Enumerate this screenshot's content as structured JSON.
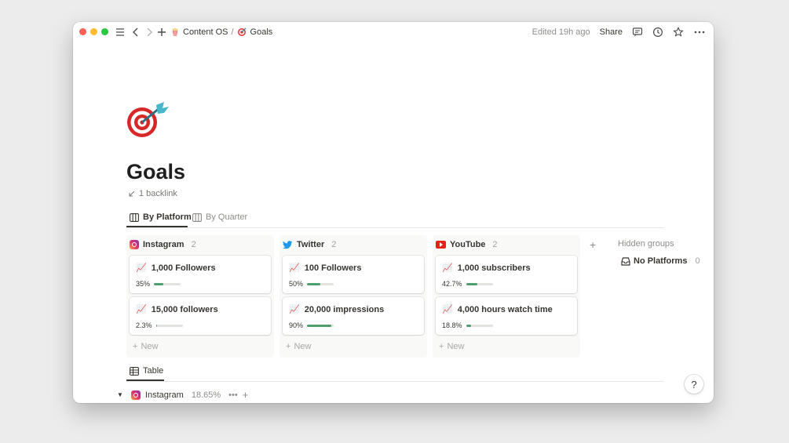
{
  "window": {
    "dot_colors": [
      "#fe5f57",
      "#febc2e",
      "#28c840"
    ]
  },
  "breadcrumb": {
    "workspace": "Content OS",
    "separator": "/",
    "page": "Goals"
  },
  "topbar": {
    "edited": "Edited 19h ago",
    "share": "Share"
  },
  "page": {
    "title": "Goals",
    "backlink": "1 backlink"
  },
  "views": {
    "tab1": "By Platform",
    "tab2": "By Quarter"
  },
  "board": {
    "columns": [
      {
        "name": "Instagram",
        "count": "2",
        "icon": "instagram-icon",
        "cards": [
          {
            "title": "1,000 Followers",
            "progress_label": "35%",
            "progress": 0.35
          },
          {
            "title": "15,000 followers",
            "progress_label": "2.3%",
            "progress": 0.023
          }
        ]
      },
      {
        "name": "Twitter",
        "count": "2",
        "icon": "twitter-icon",
        "cards": [
          {
            "title": "100 Followers",
            "progress_label": "50%",
            "progress": 0.5
          },
          {
            "title": "20,000 impressions",
            "progress_label": "90%",
            "progress": 0.9
          }
        ]
      },
      {
        "name": "YouTube",
        "count": "2",
        "icon": "youtube-icon",
        "cards": [
          {
            "title": "1,000 subscribers",
            "progress_label": "42.7%",
            "progress": 0.427
          },
          {
            "title": "4,000 hours watch time",
            "progress_label": "18.8%",
            "progress": 0.188
          }
        ]
      }
    ],
    "new_label": "New",
    "hidden_groups": "Hidden groups",
    "no_platforms": {
      "label": "No Platforms",
      "count": "0"
    }
  },
  "table_view": {
    "tab": "Table",
    "group": {
      "name": "Instagram",
      "value": "18.65%"
    }
  },
  "help": "?",
  "colors": {
    "progress_fill": "#4d9e6a",
    "accent_text": "#37352f"
  }
}
